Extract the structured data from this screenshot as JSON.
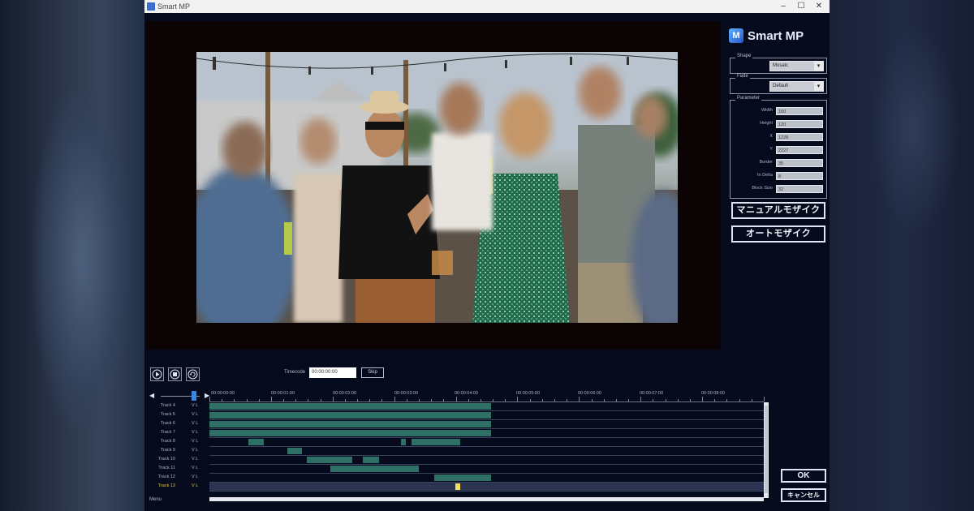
{
  "window": {
    "title": "Smart MP"
  },
  "logo": {
    "mark": "M",
    "text": "Smart MP"
  },
  "shape_group": {
    "legend": "Shape",
    "value": "Mosaic"
  },
  "fade_group": {
    "legend": "Fade",
    "value": "Default"
  },
  "parameter_group": {
    "legend": "Parameter",
    "rows": [
      {
        "label": "Width",
        "value": "160"
      },
      {
        "label": "Height",
        "value": "120"
      },
      {
        "label": "X",
        "value": "1228"
      },
      {
        "label": "Y",
        "value": "2227"
      },
      {
        "label": "Border",
        "value": "35"
      },
      {
        "label": "In Delta",
        "value": "8"
      },
      {
        "label": "Block Size",
        "value": "32"
      }
    ]
  },
  "buttons": {
    "manual_mosaic": "マニュアルモザイク",
    "auto_mosaic": "オートモザイク",
    "ok": "OK",
    "cancel": "キャンセル",
    "skip": "Skip"
  },
  "transport": {
    "timecode_label": "Timecode",
    "timecode_value": "00:00:00:00"
  },
  "ruler": {
    "labels": [
      "00:00:00:00",
      "00:00:01:00",
      "00:00:02:00",
      "00:00:03:00",
      "00:00:04:00",
      "00:00:05:00",
      "00:00:06:00",
      "00:00:07:00",
      "00:00:08:00"
    ]
  },
  "tracks": [
    {
      "name": "Track 4",
      "flags": "V L",
      "selected": false,
      "clips": [
        [
          0,
          0.508
        ]
      ]
    },
    {
      "name": "Track 5",
      "flags": "V L",
      "selected": false,
      "clips": [
        [
          0,
          0.508
        ]
      ]
    },
    {
      "name": "Track 6",
      "flags": "V L",
      "selected": false,
      "clips": [
        [
          0,
          0.508
        ]
      ]
    },
    {
      "name": "Track 7",
      "flags": "V L",
      "selected": false,
      "clips": [
        [
          0,
          0.508
        ]
      ]
    },
    {
      "name": "Track 8",
      "flags": "V L",
      "selected": false,
      "clips": [
        [
          0.07,
          0.098
        ],
        [
          0.345,
          0.355
        ],
        [
          0.365,
          0.453
        ]
      ]
    },
    {
      "name": "Track 9",
      "flags": "V L",
      "selected": false,
      "clips": [
        [
          0.14,
          0.167
        ]
      ]
    },
    {
      "name": "Track 10",
      "flags": "V L",
      "selected": false,
      "clips": [
        [
          0.175,
          0.258
        ],
        [
          0.276,
          0.306
        ]
      ]
    },
    {
      "name": "Track 11",
      "flags": "V L",
      "selected": false,
      "clips": [
        [
          0.218,
          0.378
        ]
      ]
    },
    {
      "name": "Track 12",
      "flags": "V L",
      "selected": false,
      "clips": [
        [
          0.405,
          0.508
        ]
      ]
    },
    {
      "name": "Track 13",
      "flags": "V L",
      "selected": true,
      "clips": []
    }
  ],
  "cursor_position": 0.443,
  "menu_label": "Menu",
  "icons": {
    "play": "play-icon",
    "stop": "stop-icon",
    "loop": "loop-icon"
  },
  "colors": {
    "app_background": "#050a1c",
    "clip": "#2e6f66",
    "accent_blue": "#3a84e6",
    "cursor": "#f1e25a"
  }
}
